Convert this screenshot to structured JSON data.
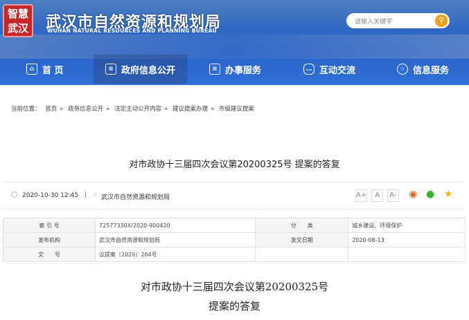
{
  "header": {
    "logo_text": "智慧武汉",
    "site_name": "武汉市自然资源和规划局",
    "site_name_en": "WUHAN NATURAL RESOURCES AND PLANNING BUREAU",
    "search_placeholder": "请输入关键字"
  },
  "nav": [
    {
      "label": "首 页",
      "icon": "home-icon"
    },
    {
      "label": "政府信息公开",
      "icon": "document-icon"
    },
    {
      "label": "办事服务",
      "icon": "document-icon"
    },
    {
      "label": "互动交流",
      "icon": "chat-icon"
    },
    {
      "label": "信息服务",
      "icon": "star-icon"
    }
  ],
  "breadcrumb": {
    "prefix": "当前位置：",
    "items": [
      "首页",
      "政务信息公开",
      "法定主动公开内容",
      "建议提案办理",
      "市级建议提案"
    ],
    "sep": "»"
  },
  "article": {
    "title": "对市政协十三届四次会议第20200325号 提案的答复",
    "date": "2020-10-30 12:45",
    "source": "武汉市自然资源和规划局",
    "font_buttons": [
      "A+",
      "A",
      "A-"
    ],
    "body_title_1": "对市政协十三届四次会议第20200325号",
    "body_title_2": "提案的答复"
  },
  "info_table": {
    "rows": [
      {
        "l1": "索 引 号",
        "v1": "72577330X/2020-900420",
        "l2": "分　　类",
        "v2": "城乡建设、环境保护"
      },
      {
        "l1": "发布机构",
        "v1": "武汉市自然资源和规划局",
        "l2": "发文日期",
        "v2": "2020-08-13"
      },
      {
        "l1": "文　　号",
        "v1": "议提案〔2020〕204号",
        "l2": "",
        "v2": ""
      }
    ]
  }
}
